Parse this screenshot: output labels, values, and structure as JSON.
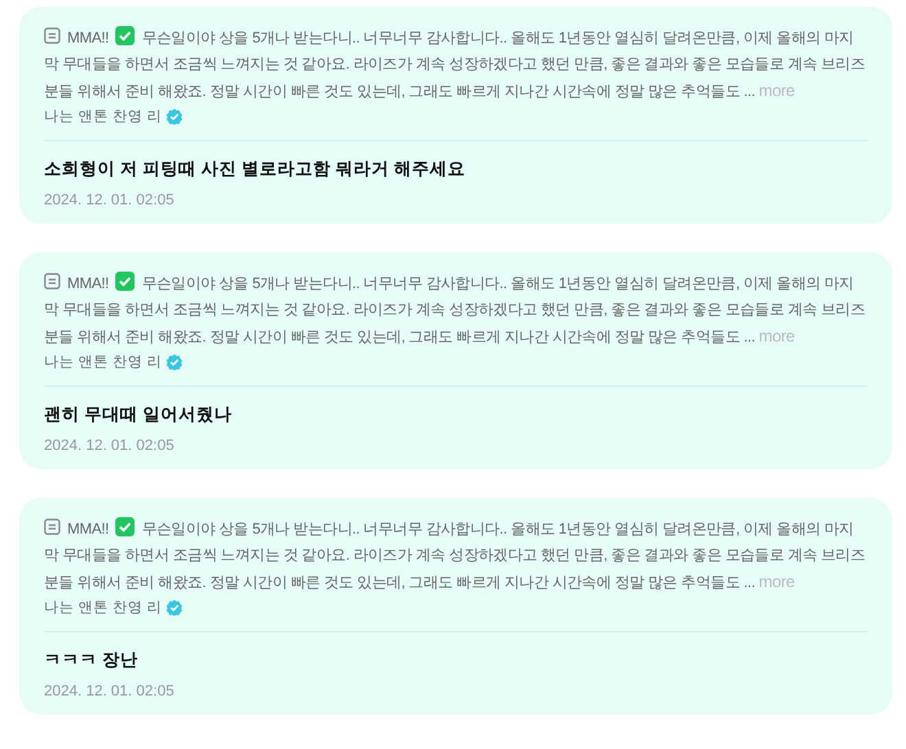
{
  "posts": [
    {
      "quote_title": "MMA!!",
      "quote_text": "무슨일이야 상을 5개나 받는다니.. 너무너무 감사합니다.. 올해도 1년동안 열심히 달려온만큼, 이제 올해의 마지막 무대들을 하면서 조금씩 느껴지는 것 같아요. 라이즈가 계속 성장하겠다고 했던 만큼, 좋은 결과와 좋은 모습들로 계속 브리즈분들 위해서 준비 해왔죠. 정말 시간이 빠른 것도 있는데, 그래도 빠르게 지나간 시간속에 정말 많은 추억들도 ...",
      "more": "more",
      "author": "나는 앤톤 찬영 리",
      "verified": true,
      "comment": "소희형이 저 피팅때 사진 별로라고함 뭐라거 해주세요",
      "time": "2024. 12. 01. 02:05"
    },
    {
      "quote_title": "MMA!!",
      "quote_text": "무슨일이야 상을 5개나 받는다니.. 너무너무 감사합니다.. 올해도 1년동안 열심히 달려온만큼, 이제 올해의 마지막 무대들을 하면서 조금씩 느껴지는 것 같아요. 라이즈가 계속 성장하겠다고 했던 만큼, 좋은 결과와 좋은 모습들로 계속 브리즈분들 위해서 준비 해왔죠. 정말 시간이 빠른 것도 있는데, 그래도 빠르게 지나간 시간속에 정말 많은 추억들도 ...",
      "more": "more",
      "author": "나는 앤톤 찬영 리",
      "verified": true,
      "comment": "괜히 무대때 일어서줬나",
      "time": "2024. 12. 01. 02:05"
    },
    {
      "quote_title": "MMA!!",
      "quote_text": "무슨일이야 상을 5개나 받는다니.. 너무너무 감사합니다.. 올해도 1년동안 열심히 달려온만큼, 이제 올해의 마지막 무대들을 하면서 조금씩 느껴지는 것 같아요. 라이즈가 계속 성장하겠다고 했던 만큼, 좋은 결과와 좋은 모습들로 계속 브리즈분들 위해서 준비 해왔죠. 정말 시간이 빠른 것도 있는데, 그래도 빠르게 지나간 시간속에 정말 많은 추억들도 ...",
      "more": "more",
      "author": "나는 앤톤 찬영 리",
      "verified": true,
      "comment": "ㅋㅋㅋ 장난",
      "time": "2024. 12. 01. 02:05"
    }
  ]
}
